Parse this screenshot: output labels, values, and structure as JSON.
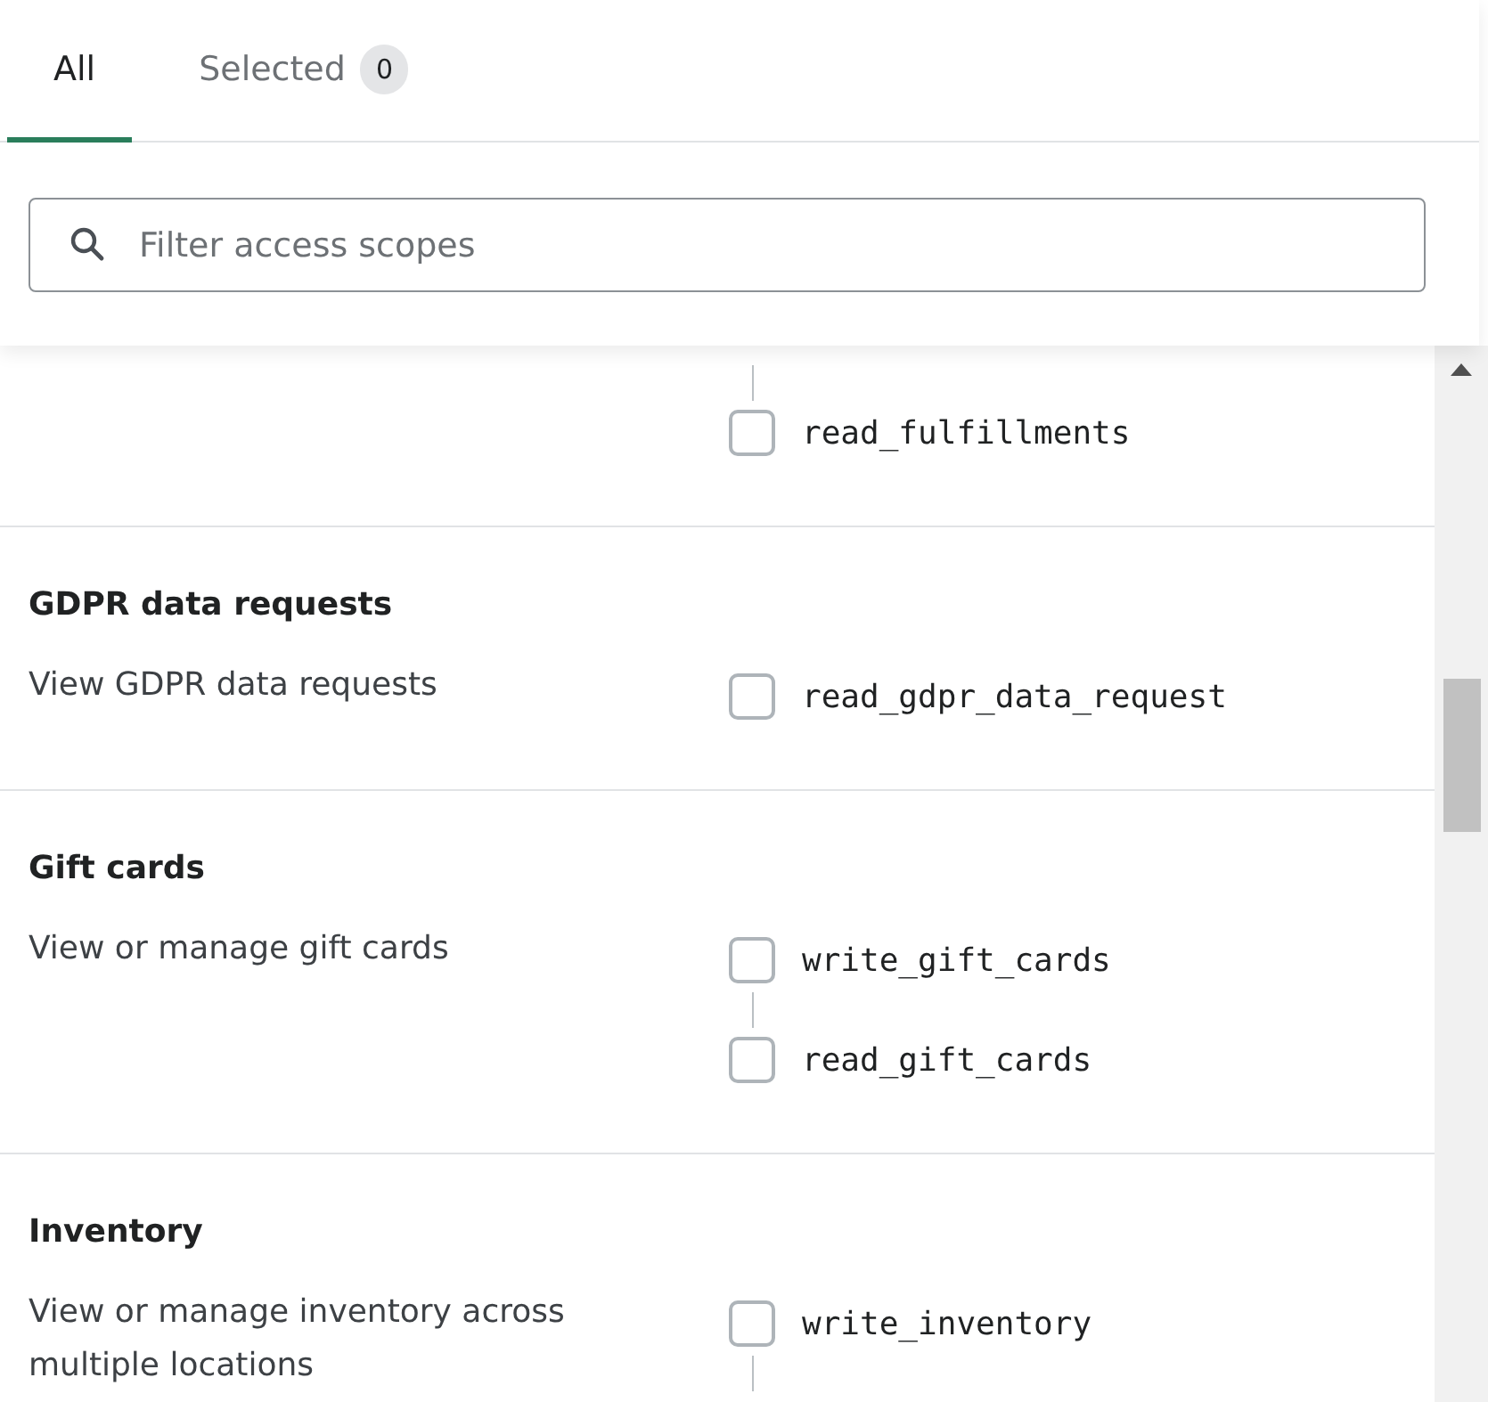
{
  "tabs": [
    {
      "label": "All",
      "selected": true
    },
    {
      "label": "Selected",
      "selected": false,
      "badge": "0"
    }
  ],
  "search": {
    "placeholder": "Filter access scopes"
  },
  "sections": [
    {
      "continues_from_above": true,
      "scopes": [
        {
          "name": "read_fulfillments",
          "checked": false
        }
      ]
    },
    {
      "title": "GDPR data requests",
      "description": "View GDPR data requests",
      "scopes": [
        {
          "name": "read_gdpr_data_request",
          "checked": false
        }
      ]
    },
    {
      "title": "Gift cards",
      "description": "View or manage gift cards",
      "scopes": [
        {
          "name": "write_gift_cards",
          "checked": false
        },
        {
          "name": "read_gift_cards",
          "checked": false
        }
      ]
    },
    {
      "title": "Inventory",
      "description": "View or manage inventory across multiple locations",
      "continues_below": true,
      "scopes": [
        {
          "name": "write_inventory",
          "checked": false
        }
      ]
    }
  ]
}
